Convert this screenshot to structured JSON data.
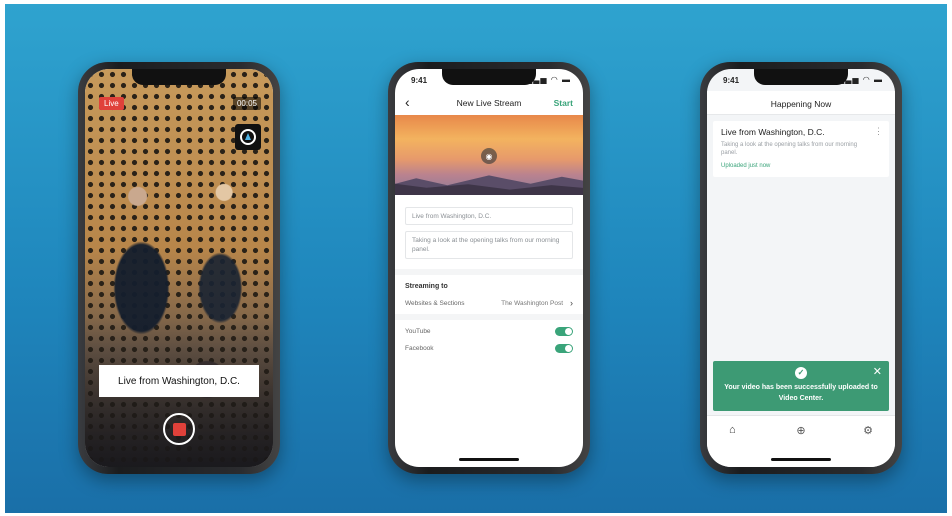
{
  "phone1": {
    "live_badge": "Live",
    "timer": "00:05",
    "title_card": "Live from Washington, D.C."
  },
  "phone2": {
    "status_time": "9:41",
    "nav_title": "New Live Stream",
    "start_label": "Start",
    "title_value": "Live from Washington, D.C.",
    "description_value": "Taking a look at the opening talks from our morning panel.",
    "streaming_to_label": "Streaming to",
    "websites_label": "Websites & Sections",
    "websites_value": "The Washington Post",
    "youtube_label": "YouTube",
    "facebook_label": "Facebook"
  },
  "phone3": {
    "status_time": "9:41",
    "nav_title": "Happening Now",
    "card_title": "Live from Washington, D.C.",
    "card_desc": "Taking a look at the opening talks from our morning panel.",
    "card_status": "Uploaded just now",
    "toast_message": "Your video has been successfully uploaded to Video Center."
  },
  "colors": {
    "accent_green": "#3aa47a",
    "live_red": "#e0413a",
    "background_blue": "#1f87bd"
  }
}
